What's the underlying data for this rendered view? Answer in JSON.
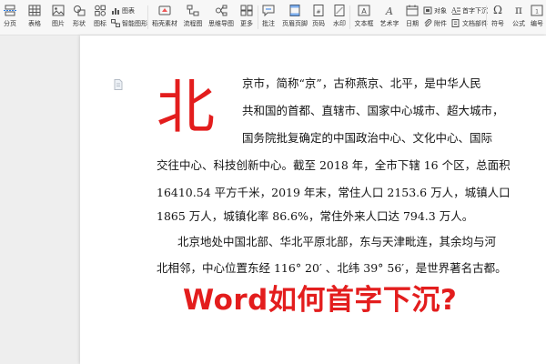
{
  "toolbar": {
    "items": [
      {
        "label": "分页",
        "icon": "page-break-icon"
      },
      {
        "label": "表格",
        "icon": "table-icon"
      },
      {
        "label": "图片",
        "icon": "picture-icon"
      },
      {
        "label": "形状",
        "icon": "shapes-icon"
      },
      {
        "label": "图标",
        "icon": "icons-icon"
      },
      {
        "label": "图表",
        "icon": "chart-icon"
      },
      {
        "label": "智能图形",
        "icon": "smart-graphic-icon"
      },
      {
        "label": "稻壳素材",
        "icon": "docer-material-icon"
      },
      {
        "label": "流程图",
        "icon": "flowchart-icon"
      },
      {
        "label": "思维导图",
        "icon": "mindmap-icon"
      },
      {
        "label": "更多",
        "icon": "more-icon"
      },
      {
        "label": "批注",
        "icon": "comment-icon"
      },
      {
        "label": "页眉页脚",
        "icon": "header-footer-icon"
      },
      {
        "label": "页码",
        "icon": "page-number-icon"
      },
      {
        "label": "水印",
        "icon": "watermark-icon"
      },
      {
        "label": "文本框",
        "icon": "textbox-icon"
      },
      {
        "label": "艺术字",
        "icon": "wordart-icon"
      },
      {
        "label": "日期",
        "icon": "date-icon"
      },
      {
        "label": "对象",
        "icon": "object-icon"
      },
      {
        "label": "附件",
        "icon": "attachment-icon"
      },
      {
        "label": "首字下沉",
        "icon": "dropcap-icon"
      },
      {
        "label": "文档部件",
        "icon": "doc-parts-icon"
      },
      {
        "label": "符号",
        "icon": "symbol-icon"
      },
      {
        "label": "公式",
        "icon": "formula-icon"
      },
      {
        "label": "编号",
        "icon": "numbering-icon"
      }
    ]
  },
  "document": {
    "dropcap": "北",
    "paragraph1_lines": [
      "京市，简称“京”，古称燕京、北平，是中华人民",
      "共和国的首都、直辖市、国家中心城市、超大城市，",
      "国务院批复确定的中国政治中心、文化中心、国际",
      "交往中心、科技创新中心。截至 2018 年，全市下辖 16 个区，总面积",
      "16410.54 平方千米，2019 年末，常住人口 2153.6 万人，城镇人口",
      "1865 万人，城镇化率 86.6%，常住外来人口达 794.3 万人。"
    ],
    "paragraph2_lines": [
      "北京地处中国北部、华北平原北部，东与天津毗连，其余均与河",
      "北相邻，中心位置东经 116° 20′ 、北纬 39° 56′，是世界著名古都。"
    ]
  },
  "overlay": {
    "caption": "Word如何首字下沉?"
  },
  "colors": {
    "accent_red": "#e31d1d",
    "toolbar_bg": "#f7f7f7",
    "workspace_bg": "#eeeeee"
  }
}
